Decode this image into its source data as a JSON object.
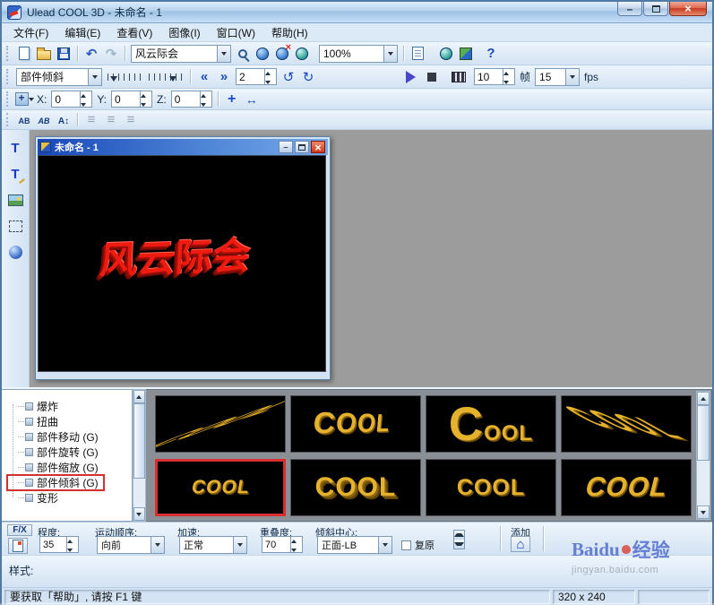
{
  "window": {
    "title": "Ulead COOL 3D - 未命名 - 1"
  },
  "menu": {
    "items": [
      {
        "label": "文件(F)"
      },
      {
        "label": "编辑(E)"
      },
      {
        "label": "查看(V)"
      },
      {
        "label": "图像(I)"
      },
      {
        "label": "窗口(W)"
      },
      {
        "label": "帮助(H)"
      }
    ]
  },
  "toolbar_main": {
    "preset_combo": "风云际会",
    "zoom_combo": "100%"
  },
  "toolbar_anim": {
    "effect_combo": "部件倾斜",
    "current_frame": "2",
    "duration": "10",
    "frame_unit_label": "帧",
    "fps_combo": "15",
    "fps_label": "fps"
  },
  "toolbar_position": {
    "x_label": "X:",
    "x_value": "0",
    "y_label": "Y:",
    "y_value": "0",
    "z_label": "Z:",
    "z_value": "0"
  },
  "child_window": {
    "title": "未命名 - 1",
    "canvas_text": "风云际会"
  },
  "effects_panel": {
    "tree_items": [
      {
        "label": "爆炸"
      },
      {
        "label": "扭曲"
      },
      {
        "label": "部件移动 (G)"
      },
      {
        "label": "部件旋转 (G)"
      },
      {
        "label": "部件缩放 (G)"
      },
      {
        "label": "部件倾斜 (G)"
      },
      {
        "label": "变形"
      }
    ],
    "thumbnails": [
      {
        "label": "COOL"
      },
      {
        "label": "COOL"
      },
      {
        "label": "COOL"
      },
      {
        "label": "COOL"
      },
      {
        "label": "COOL"
      },
      {
        "label": "COOL"
      },
      {
        "label": "COOL"
      },
      {
        "label": "COOL"
      }
    ]
  },
  "attribute_bar": {
    "fx_label": "F/X",
    "degree_label": "程度:",
    "degree_value": "35",
    "motion_order_label": "运动顺序:",
    "motion_order_value": "向前",
    "accel_label": "加速:",
    "accel_value": "正常",
    "overlap_label": "重叠度:",
    "overlap_value": "70",
    "tilt_center_label": "倾斜中心:",
    "tilt_center_value": "正面-LB",
    "restore_label": "复原",
    "add_label": "添加"
  },
  "style_bar": {
    "label": "样式:"
  },
  "status_bar": {
    "help_text": "要获取「帮助」, 请按 F1 键",
    "canvas_size": "320 x 240"
  },
  "watermark": {
    "brand": "Baidu",
    "brand_suffix": "经验",
    "url": "jingyan.baidu.com"
  }
}
